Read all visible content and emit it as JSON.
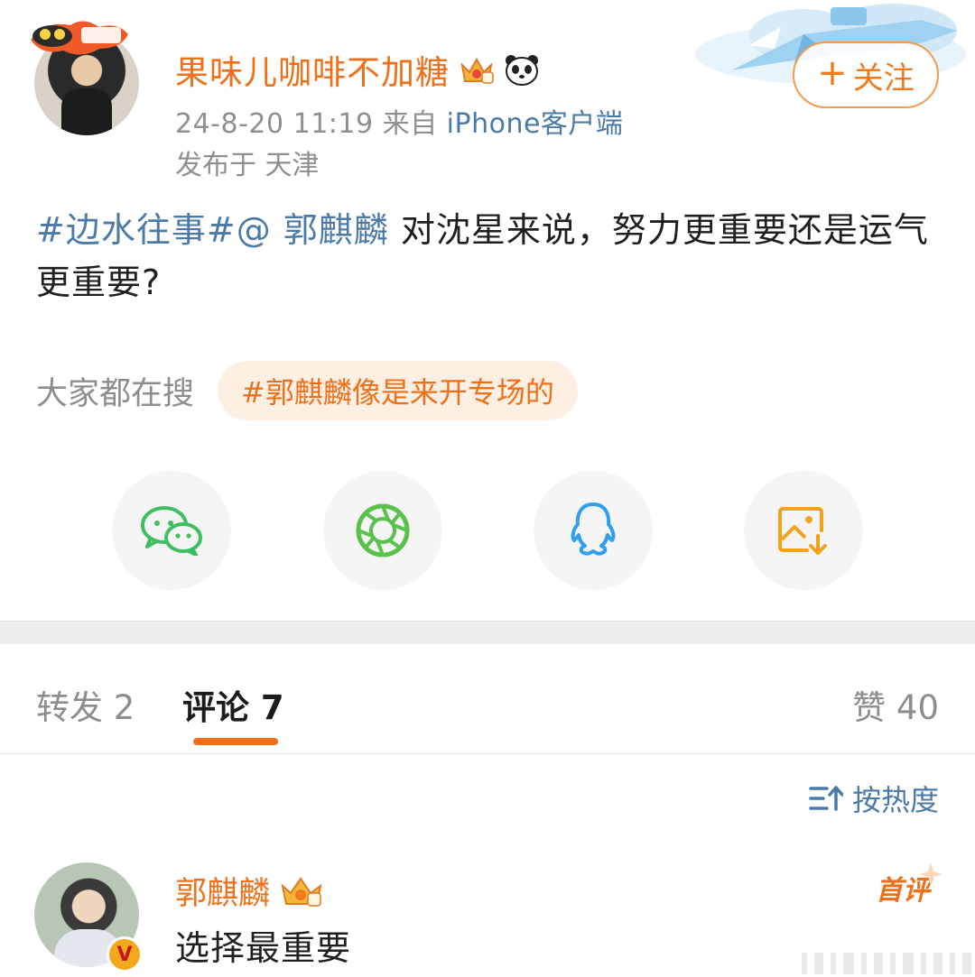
{
  "post": {
    "author": "果味儿咖啡不加糖",
    "date": "24-8-20 11:19",
    "source_prefix": "来自",
    "client": "iPhone客户端",
    "location": "发布于 天津",
    "follow_label": "关注",
    "content_tag": "#边水往事#",
    "content_mention": "@ 郭麒麟",
    "content_text": " 对沈星来说，努力更重要还是运气更重要?",
    "search_label": "大家都在搜",
    "search_topic": "#郭麒麟像是来开专场的"
  },
  "share_icons": [
    "wechat-icon",
    "moments-icon",
    "qq-icon",
    "save-image-icon"
  ],
  "tabs": {
    "repost": "转发 2",
    "comment": "评论 7",
    "like": "赞 40"
  },
  "sort_label": "按热度",
  "comment": {
    "author": "郭麒麟",
    "text": "选择最重要",
    "first_label": "首评",
    "verified_mark": "V"
  },
  "colors": {
    "accent": "#f0701a",
    "link": "#4b7aa8",
    "muted": "#8d8d8d",
    "pill_bg": "#fdefe2"
  }
}
